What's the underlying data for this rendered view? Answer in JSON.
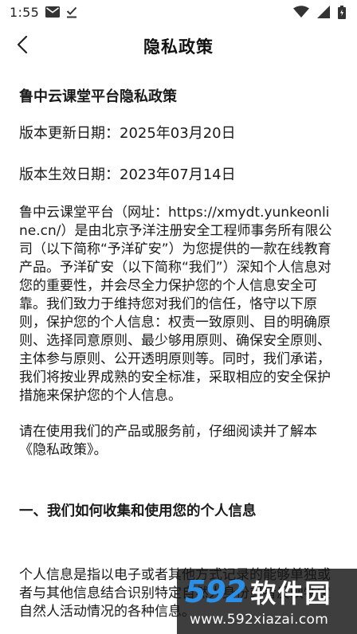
{
  "status_bar": {
    "time": "1:55",
    "icons": [
      "mail-icon",
      "download-done-icon",
      "wifi-icon",
      "signal-icon",
      "battery-icon"
    ]
  },
  "header": {
    "title": "隐私政策",
    "back_icon": "back-arrow-icon"
  },
  "document": {
    "heading": "鲁中云课堂平台隐私政策",
    "update_date": "版本更新日期：2025年03月20日",
    "effective_date": "版本生效日期：2023年07月14日",
    "intro": "鲁中云课堂平台（网址：https://xmydt.yunkeonline.cn/）是由北京予洋注册安全工程师事务所有限公司（以下简称“予洋矿安”）为您提供的一款在线教育产品。予洋矿安（以下简称“我们”）深知个人信息对您的重要性，并会尽全力保护您的个人信息安全可靠。我们致力于维持您对我们的信任，恪守以下原则，保护您的个人信息：权责一致原则、目的明确原则、选择同意原则、最少够用原则、确保安全原则、主体参与原则、公开透明原则等。同时，我们承诺，我们将按业界成熟的安全标准，采取相应的安全保护措施来保护您的个人信息。",
    "read_notice": "请在使用我们的产品或服务前，仔细阅读并了解本《隐私政策》。",
    "section1_title": "一、我们如何收集和使用您的个人信息",
    "section1_text": "个人信息是指以电子或者其他方式记录的能够单独或者与其他信息结合识别特定自然人身份或者反映特定自然人活动情况的各种信息。"
  },
  "watermark": {
    "logo_number": "592",
    "logo_text": "软件园",
    "url": "www.592xiazai.com",
    "number_color": "#2a8fe6"
  }
}
